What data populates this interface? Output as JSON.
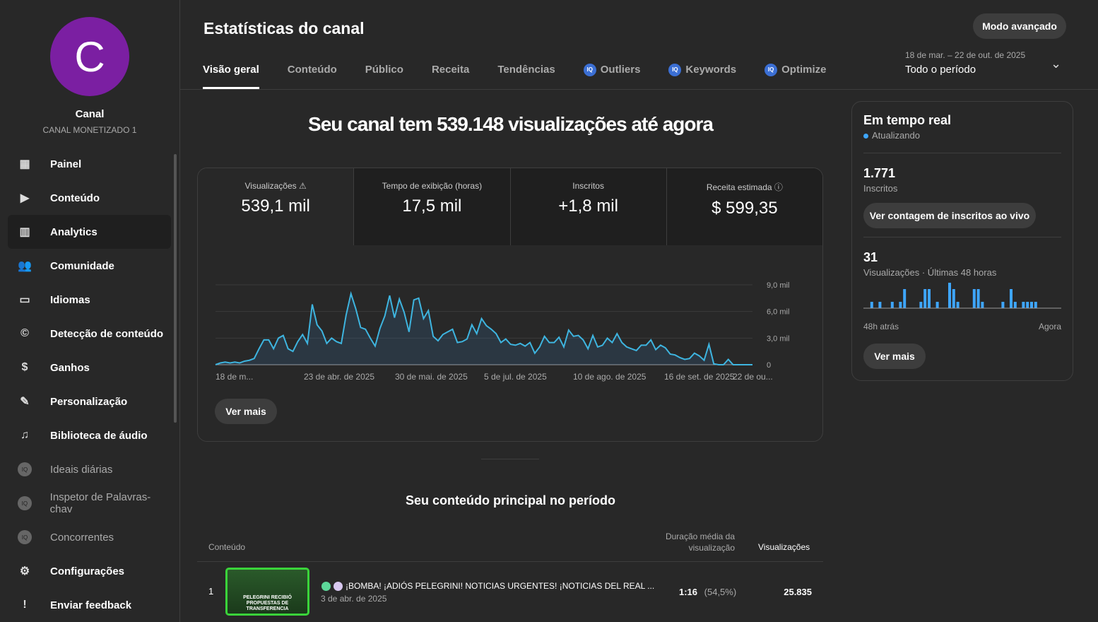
{
  "channel": {
    "initial": "C",
    "name": "Canal",
    "status": "CANAL MONETIZADO 1"
  },
  "nav": [
    {
      "label": "Painel",
      "icon": "dashboard-icon",
      "g": "▦"
    },
    {
      "label": "Conteúdo",
      "icon": "content-icon",
      "g": "▶"
    },
    {
      "label": "Analytics",
      "icon": "analytics-icon",
      "g": "▥",
      "active": true
    },
    {
      "label": "Comunidade",
      "icon": "community-icon",
      "g": "👥"
    },
    {
      "label": "Idiomas",
      "icon": "subtitles-icon",
      "g": "▭"
    },
    {
      "label": "Detecção de conteúdo",
      "icon": "copyright-icon",
      "g": "©"
    },
    {
      "label": "Ganhos",
      "icon": "dollar-icon",
      "g": "$"
    },
    {
      "label": "Personalização",
      "icon": "magic-wand-icon",
      "g": "✎"
    },
    {
      "label": "Biblioteca de áudio",
      "icon": "audio-library-icon",
      "g": "♫"
    },
    {
      "label": "Ideais diárias",
      "icon": "vidiq-icon",
      "g": "IQ",
      "ext": true
    },
    {
      "label": "Inspetor de Palavras-chav",
      "icon": "vidiq-icon",
      "g": "IQ",
      "ext": true
    },
    {
      "label": "Concorrentes",
      "icon": "vidiq-icon",
      "g": "IQ",
      "ext": true
    },
    {
      "label": "Configurações",
      "icon": "gear-icon",
      "g": "⚙"
    },
    {
      "label": "Enviar feedback",
      "icon": "feedback-icon",
      "g": "!"
    }
  ],
  "header": {
    "title": "Estatísticas do canal",
    "advanced": "Modo avançado",
    "range_label": "18 de mar. – 22 de out. de 2025",
    "range_value": "Todo o período"
  },
  "tabs": [
    {
      "label": "Visão geral",
      "active": true
    },
    {
      "label": "Conteúdo"
    },
    {
      "label": "Público"
    },
    {
      "label": "Receita"
    },
    {
      "label": "Tendências"
    },
    {
      "label": "Outliers",
      "badge": true
    },
    {
      "label": "Keywords",
      "badge": true
    },
    {
      "label": "Optimize",
      "badge": true
    }
  ],
  "headline": "Seu canal tem 539.148 visualizações até agora",
  "metrics": [
    {
      "label": "Visualizações ⚠",
      "value": "539,1 mil"
    },
    {
      "label": "Tempo de exibição (horas)",
      "value": "17,5 mil"
    },
    {
      "label": "Inscritos",
      "value": "+1,8 mil"
    },
    {
      "label": "Receita estimada ⓘ",
      "value": "$ 599,35"
    }
  ],
  "see_more": "Ver mais",
  "chart_data": {
    "type": "area",
    "title": "Visualizações",
    "ylim": [
      0,
      9000
    ],
    "yticks": [
      "0",
      "3,0 mil",
      "6,0 mil",
      "9,0 mil"
    ],
    "xticks": [
      "18 de m...",
      "23 de abr. de 2025",
      "30 de mai. de 2025",
      "5 de jul. de 2025",
      "10 de ago. de 2025",
      "16 de set. de 2025",
      "22 de ou..."
    ],
    "color": "#3ea6ff",
    "values": [
      0,
      200,
      300,
      200,
      300,
      200,
      400,
      500,
      700,
      1800,
      2800,
      2800,
      1800,
      3000,
      3300,
      1800,
      1500,
      2600,
      3400,
      2400,
      6800,
      4500,
      3800,
      2400,
      3000,
      2600,
      2400,
      5600,
      8000,
      6300,
      4200,
      4000,
      3000,
      2100,
      4100,
      5500,
      7800,
      5300,
      7400,
      5900,
      3700,
      7300,
      7500,
      5200,
      6100,
      3200,
      2700,
      3400,
      3700,
      4000,
      2500,
      2600,
      2900,
      4500,
      3500,
      5200,
      4400,
      4000,
      3500,
      2500,
      2900,
      2300,
      2200,
      2400,
      2100,
      2500,
      1300,
      2000,
      3200,
      2500,
      2500,
      3100,
      2000,
      3900,
      3200,
      3300,
      2800,
      1800,
      3300,
      2000,
      2200,
      3000,
      2500,
      3500,
      2500,
      2000,
      1800,
      1600,
      2200,
      2200,
      2800,
      1700,
      2200,
      1900,
      1200,
      1100,
      800,
      600,
      700,
      1300,
      1000,
      500,
      2300,
      100,
      0,
      0,
      600,
      0,
      0,
      0,
      0,
      0
    ]
  },
  "realtime": {
    "title": "Em tempo real",
    "status": "Atualizando",
    "subs": "1.771",
    "subs_label": "Inscritos",
    "live_btn": "Ver contagem de inscritos ao vivo",
    "views": "31",
    "views_label": "Visualizações · Últimas 48 horas",
    "start": "48h atrás",
    "end": "Agora",
    "more": "Ver mais",
    "bars": [
      0,
      1,
      0,
      1,
      0,
      0,
      1,
      0,
      1,
      3,
      0,
      0,
      0,
      1,
      3,
      3,
      0,
      1,
      0,
      0,
      4,
      3,
      1,
      0,
      0,
      0,
      3,
      3,
      1,
      0,
      0,
      0,
      0,
      1,
      0,
      3,
      1,
      0,
      1,
      1,
      1,
      1,
      0,
      0,
      0,
      0,
      0,
      0
    ]
  },
  "top": {
    "title": "Seu conteúdo principal no período",
    "col_content": "Conteúdo",
    "col_avd": "Duração média da visualização",
    "col_views": "Visualizações",
    "rows": [
      {
        "rank": "1",
        "title": "¡BOMBA! ¡ADIÓS PELEGRINI! NOTICIAS URGENTES! ¡NOTICIAS DEL REAL ...",
        "date": "3 de abr. de 2025",
        "avd": "1:16",
        "pct": "(54,5%)",
        "views": "25.835",
        "thumb_text": "PELEGRINI RECIBIÓ PROPUESTAS DE TRANSFERENCIA"
      }
    ]
  }
}
